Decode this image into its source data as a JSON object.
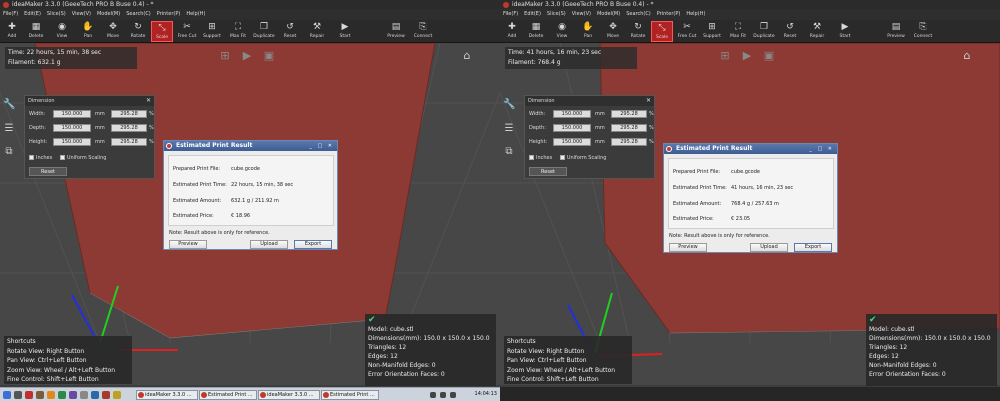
{
  "window": {
    "title": "ideaMaker 3.3.0 (GeeeTech PRO B Buse 0.4) - *"
  },
  "menu": [
    "File(F)",
    "Edit(E)",
    "Slice(S)",
    "View(V)",
    "Model(M)",
    "Search(C)",
    "Printer(P)",
    "Help(H)"
  ],
  "toolbar": [
    {
      "label": "Add",
      "icon": "plus-icon"
    },
    {
      "label": "Delete",
      "icon": "trash-icon"
    },
    {
      "label": "View",
      "icon": "eye-icon"
    },
    {
      "label": "Pan",
      "icon": "hand-icon"
    },
    {
      "label": "Move",
      "icon": "move-icon"
    },
    {
      "label": "Rotate",
      "icon": "rotate-icon"
    },
    {
      "label": "Scale",
      "icon": "scale-icon",
      "active": true
    },
    {
      "label": "Free Cut",
      "icon": "cut-icon"
    },
    {
      "label": "Support",
      "icon": "support-icon"
    },
    {
      "label": "Max Fit",
      "icon": "maxfit-icon"
    },
    {
      "label": "Duplicate",
      "icon": "duplicate-icon"
    },
    {
      "label": "Reset",
      "icon": "reset-icon"
    },
    {
      "label": "Repair",
      "icon": "repair-icon"
    },
    {
      "label": "Start",
      "icon": "start-icon"
    },
    {
      "label": "Preview",
      "icon": "preview-icon"
    },
    {
      "label": "Connect",
      "icon": "connect-icon"
    }
  ],
  "dimension": {
    "title": "Dimension",
    "width_label": "Width:",
    "depth_label": "Depth:",
    "height_label": "Height:",
    "mm": "mm",
    "pct": "%",
    "width": "150.000",
    "depth": "150.000",
    "height": "150.000",
    "width_pct": "295.28",
    "depth_pct": "295.28",
    "height_pct": "295.28",
    "inches": "Inches",
    "uniform": "Uniform Scaling",
    "reset": "Reset"
  },
  "dialog": {
    "title": "Estimated Print Result",
    "file_label": "Prepared Print File:",
    "time_label": "Estimated Print Time:",
    "amount_label": "Estimated Amount:",
    "price_label": "Estimated Price:",
    "note": "Note: Result above is only for reference.",
    "preview": "Preview",
    "upload": "Upload",
    "export": "Export"
  },
  "left": {
    "info_time": "Time: 22 hours, 15 min, 38 sec",
    "info_filament": "Filament: 632.1 g",
    "file": "cube.gcode",
    "time": "22 hours, 15 min, 38 sec",
    "amount": "632.1 g / 211.92 m",
    "price": "€ 18.96"
  },
  "right": {
    "info_time": "Time: 41 hours, 16 min, 23 sec",
    "info_filament": "Filament: 768.4 g",
    "file": "cube.gcode",
    "time": "41 hours, 16 min, 23 sec",
    "amount": "768.4 g / 257.63 m",
    "price": "€ 23.05"
  },
  "shortcuts": [
    "Shortcuts",
    "Rotate View: Right Button",
    "Pan View: Ctrl+Left Button",
    "Zoom View: Wheel / Alt+Left Button",
    "Fine Control: Shift+Left Button"
  ],
  "model": [
    "Model: cube.stl",
    "Dimensions(mm): 150.0 x 150.0 x 150.0",
    "Triangles: 12",
    "Edges: 12",
    "Non-Manifold Edges: 0",
    "Error Orientation Faces: 0"
  ],
  "taskbar": {
    "tasks": [
      "ideaMaker 3.3.0 ...",
      "Estimated Print ...",
      "ideaMaker 3.3.0 ...",
      "Estimated Print ..."
    ],
    "clock": "14:04:13"
  },
  "colors": {
    "model": "#8e3a34",
    "active_tool": "#b22222",
    "dialog_title": "#4a6aa0"
  }
}
